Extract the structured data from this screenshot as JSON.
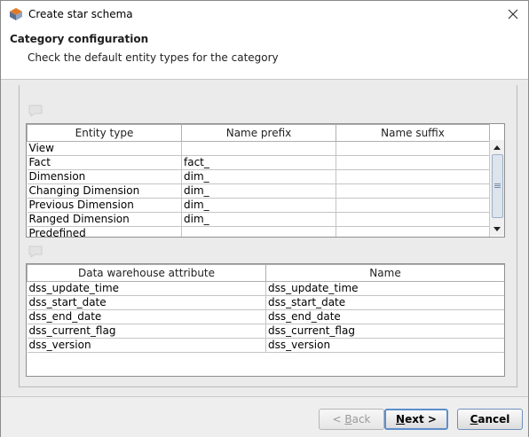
{
  "window": {
    "title": "Create star schema",
    "close_symbol": "✕"
  },
  "header": {
    "title": "Category configuration",
    "description": "Check the default entity types for the category"
  },
  "entity_table": {
    "columns": [
      "Entity type",
      "Name prefix",
      "Name suffix"
    ],
    "rows": [
      {
        "type": "View",
        "prefix": "",
        "suffix": ""
      },
      {
        "type": "Fact",
        "prefix": "fact_",
        "suffix": ""
      },
      {
        "type": "Dimension",
        "prefix": "dim_",
        "suffix": ""
      },
      {
        "type": "Changing Dimension",
        "prefix": "dim_",
        "suffix": ""
      },
      {
        "type": "Previous Dimension",
        "prefix": "dim_",
        "suffix": ""
      },
      {
        "type": "Ranged Dimension",
        "prefix": "dim_",
        "suffix": ""
      },
      {
        "type": "Predefined",
        "prefix": "",
        "suffix": ""
      }
    ]
  },
  "attribute_table": {
    "columns": [
      "Data warehouse attribute",
      "Name"
    ],
    "rows": [
      {
        "attribute": "dss_update_time",
        "name": "dss_update_time"
      },
      {
        "attribute": "dss_start_date",
        "name": "dss_start_date"
      },
      {
        "attribute": "dss_end_date",
        "name": "dss_end_date"
      },
      {
        "attribute": "dss_current_flag",
        "name": "dss_current_flag"
      },
      {
        "attribute": "dss_version",
        "name": "dss_version"
      }
    ]
  },
  "buttons": {
    "back": {
      "prefix": "< ",
      "mnemonic": "B",
      "rest": "ack"
    },
    "next": {
      "mnemonic": "N",
      "rest": "ext >"
    },
    "cancel": {
      "mnemonic": "C",
      "rest": "ancel"
    }
  },
  "icons": {
    "app": "wherescape-logo-icon",
    "comment": "comment-bubble-icon"
  }
}
